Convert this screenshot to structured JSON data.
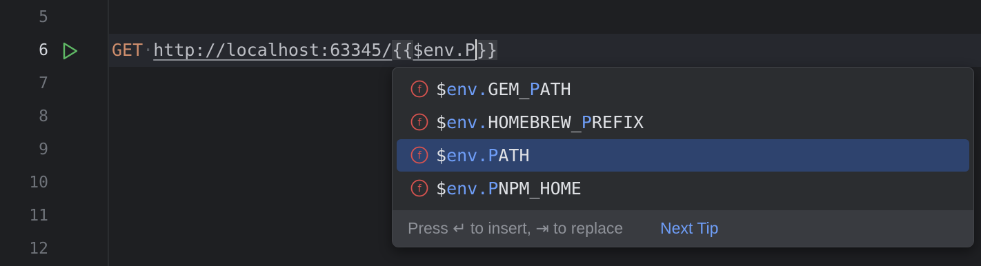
{
  "editor": {
    "line_numbers": [
      "5",
      "6",
      "7",
      "8",
      "9",
      "10",
      "11",
      "12"
    ],
    "active_line": "6",
    "code": {
      "method": "GET",
      "url": "http://localhost:63345/",
      "open_braces": "{{",
      "var_text": "$env.P",
      "close_braces": "}}"
    }
  },
  "completion": {
    "items": [
      {
        "prefix": "$",
        "qualifier": "env.",
        "before": "GEM_",
        "match": "P",
        "after": "ATH",
        "icon": "function-icon"
      },
      {
        "prefix": "$",
        "qualifier": "env.",
        "before": "HOMEBREW_",
        "match": "P",
        "after": "REFIX",
        "icon": "function-icon"
      },
      {
        "prefix": "$",
        "qualifier": "env.",
        "before": "",
        "match": "P",
        "after": "ATH",
        "icon": "function-icon",
        "selected": true
      },
      {
        "prefix": "$",
        "qualifier": "env.",
        "before": "",
        "match": "P",
        "after": "NPM_HOME",
        "icon": "function-icon"
      }
    ],
    "footer": {
      "press": "Press",
      "insert_text": "to insert,",
      "replace_text": "to replace",
      "next_tip": "Next Tip"
    }
  },
  "colors": {
    "background": "#1e1f22",
    "current_line": "#26282e",
    "popup_bg": "#2b2d30",
    "selection": "#2e436e",
    "accent": "#6f9ef8",
    "method": "#cf8e6d",
    "run_green": "#5fb865",
    "function_icon": "#d9534f"
  }
}
